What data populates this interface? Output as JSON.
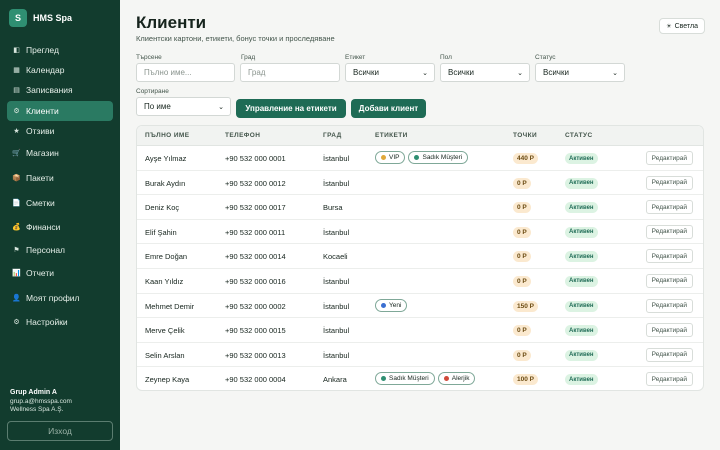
{
  "brand": {
    "logo_letter": "S",
    "name": "HMS Spa"
  },
  "nav": [
    {
      "id": "overview",
      "label": "Преглед",
      "icon": "dashboard-icon",
      "glyph": "◧"
    },
    {
      "id": "calendar",
      "label": "Календар",
      "icon": "calendar-icon",
      "glyph": "▦"
    },
    {
      "id": "bookings",
      "label": "Записвания",
      "icon": "list-icon",
      "glyph": "▤"
    },
    {
      "id": "clients",
      "label": "Клиенти",
      "icon": "clients-icon",
      "glyph": "⚙",
      "active": true
    },
    {
      "id": "reviews",
      "label": "Отзиви",
      "icon": "star-icon",
      "glyph": "★"
    },
    {
      "id": "shop",
      "label": "Магазин",
      "icon": "cart-icon",
      "glyph": "🛒"
    },
    {
      "id": "packages",
      "label": "Пакети",
      "icon": "package-icon",
      "glyph": "📦"
    },
    {
      "id": "invoices",
      "label": "Сметки",
      "icon": "invoice-icon",
      "glyph": "📄"
    },
    {
      "id": "finance",
      "label": "Финанси",
      "icon": "money-bag-icon",
      "glyph": "💰"
    },
    {
      "id": "staff",
      "label": "Персонал",
      "icon": "flag-icon",
      "glyph": "⚑"
    },
    {
      "id": "reports",
      "label": "Отчети",
      "icon": "chart-icon",
      "glyph": "📊"
    },
    {
      "id": "profile",
      "label": "Моят профил",
      "icon": "user-icon",
      "glyph": "👤"
    },
    {
      "id": "settings",
      "label": "Настройки",
      "icon": "gear-icon",
      "glyph": "⚙"
    }
  ],
  "user": {
    "name": "Grup Admin A",
    "email": "grup.a@hmsspa.com",
    "company": "Wellness Spa A.Ş."
  },
  "logout_label": "Изход",
  "page": {
    "title": "Клиенти",
    "subtitle": "Клиентски картони, етикети, бонус точки и проследяване"
  },
  "theme_button": {
    "label": "Светла",
    "glyph": "☀"
  },
  "filters": {
    "search": {
      "label": "Търсене",
      "placeholder": "Пълно име..."
    },
    "city": {
      "label": "Град",
      "placeholder": "Град"
    },
    "tag": {
      "label": "Етикет",
      "value": "Всички"
    },
    "gender": {
      "label": "Пол",
      "value": "Всички"
    },
    "status": {
      "label": "Статус",
      "value": "Всички"
    },
    "sort": {
      "label": "Сортиране",
      "value": "По име"
    }
  },
  "buttons": {
    "manage_tags": "Управление на етикети",
    "add_client": "Добави клиент"
  },
  "table": {
    "columns": {
      "name": "ПЪЛНО ИМЕ",
      "phone": "ТЕЛЕФОН",
      "city": "ГРАД",
      "tags": "ЕТИКЕТИ",
      "points": "ТОЧКИ",
      "status": "СТАТУС"
    },
    "edit_label": "Редактирай",
    "rows": [
      {
        "name": "Ayşe Yılmaz",
        "phone": "+90 532 000 0001",
        "city": "İstanbul",
        "tags": [
          {
            "label": "VIP",
            "color": "#e0a83a"
          },
          {
            "label": "Sadık Müşteri",
            "color": "#2f8f72"
          }
        ],
        "points": "440 P",
        "status": "Активен"
      },
      {
        "name": "Burak Aydın",
        "phone": "+90 532 000 0012",
        "city": "İstanbul",
        "tags": [],
        "points": "0 P",
        "status": "Активен"
      },
      {
        "name": "Deniz Koç",
        "phone": "+90 532 000 0017",
        "city": "Bursa",
        "tags": [],
        "points": "0 P",
        "status": "Активен"
      },
      {
        "name": "Elif Şahin",
        "phone": "+90 532 000 0011",
        "city": "İstanbul",
        "tags": [],
        "points": "0 P",
        "status": "Активен"
      },
      {
        "name": "Emre Doğan",
        "phone": "+90 532 000 0014",
        "city": "Kocaeli",
        "tags": [],
        "points": "0 P",
        "status": "Активен"
      },
      {
        "name": "Kaan Yıldız",
        "phone": "+90 532 000 0016",
        "city": "İstanbul",
        "tags": [],
        "points": "0 P",
        "status": "Активен"
      },
      {
        "name": "Mehmet Demir",
        "phone": "+90 532 000 0002",
        "city": "İstanbul",
        "tags": [
          {
            "label": "Yeni",
            "color": "#3b6fd1"
          }
        ],
        "points": "150 P",
        "status": "Активен"
      },
      {
        "name": "Merve Çelik",
        "phone": "+90 532 000 0015",
        "city": "İstanbul",
        "tags": [],
        "points": "0 P",
        "status": "Активен"
      },
      {
        "name": "Selin Arslan",
        "phone": "+90 532 000 0013",
        "city": "İstanbul",
        "tags": [],
        "points": "0 P",
        "status": "Активен"
      },
      {
        "name": "Zeynep Kaya",
        "phone": "+90 532 000 0004",
        "city": "Ankara",
        "tags": [
          {
            "label": "Sadık Müşteri",
            "color": "#2f8f72"
          },
          {
            "label": "Alerjik",
            "color": "#d04a3a"
          }
        ],
        "points": "100 P",
        "status": "Активен"
      }
    ]
  }
}
